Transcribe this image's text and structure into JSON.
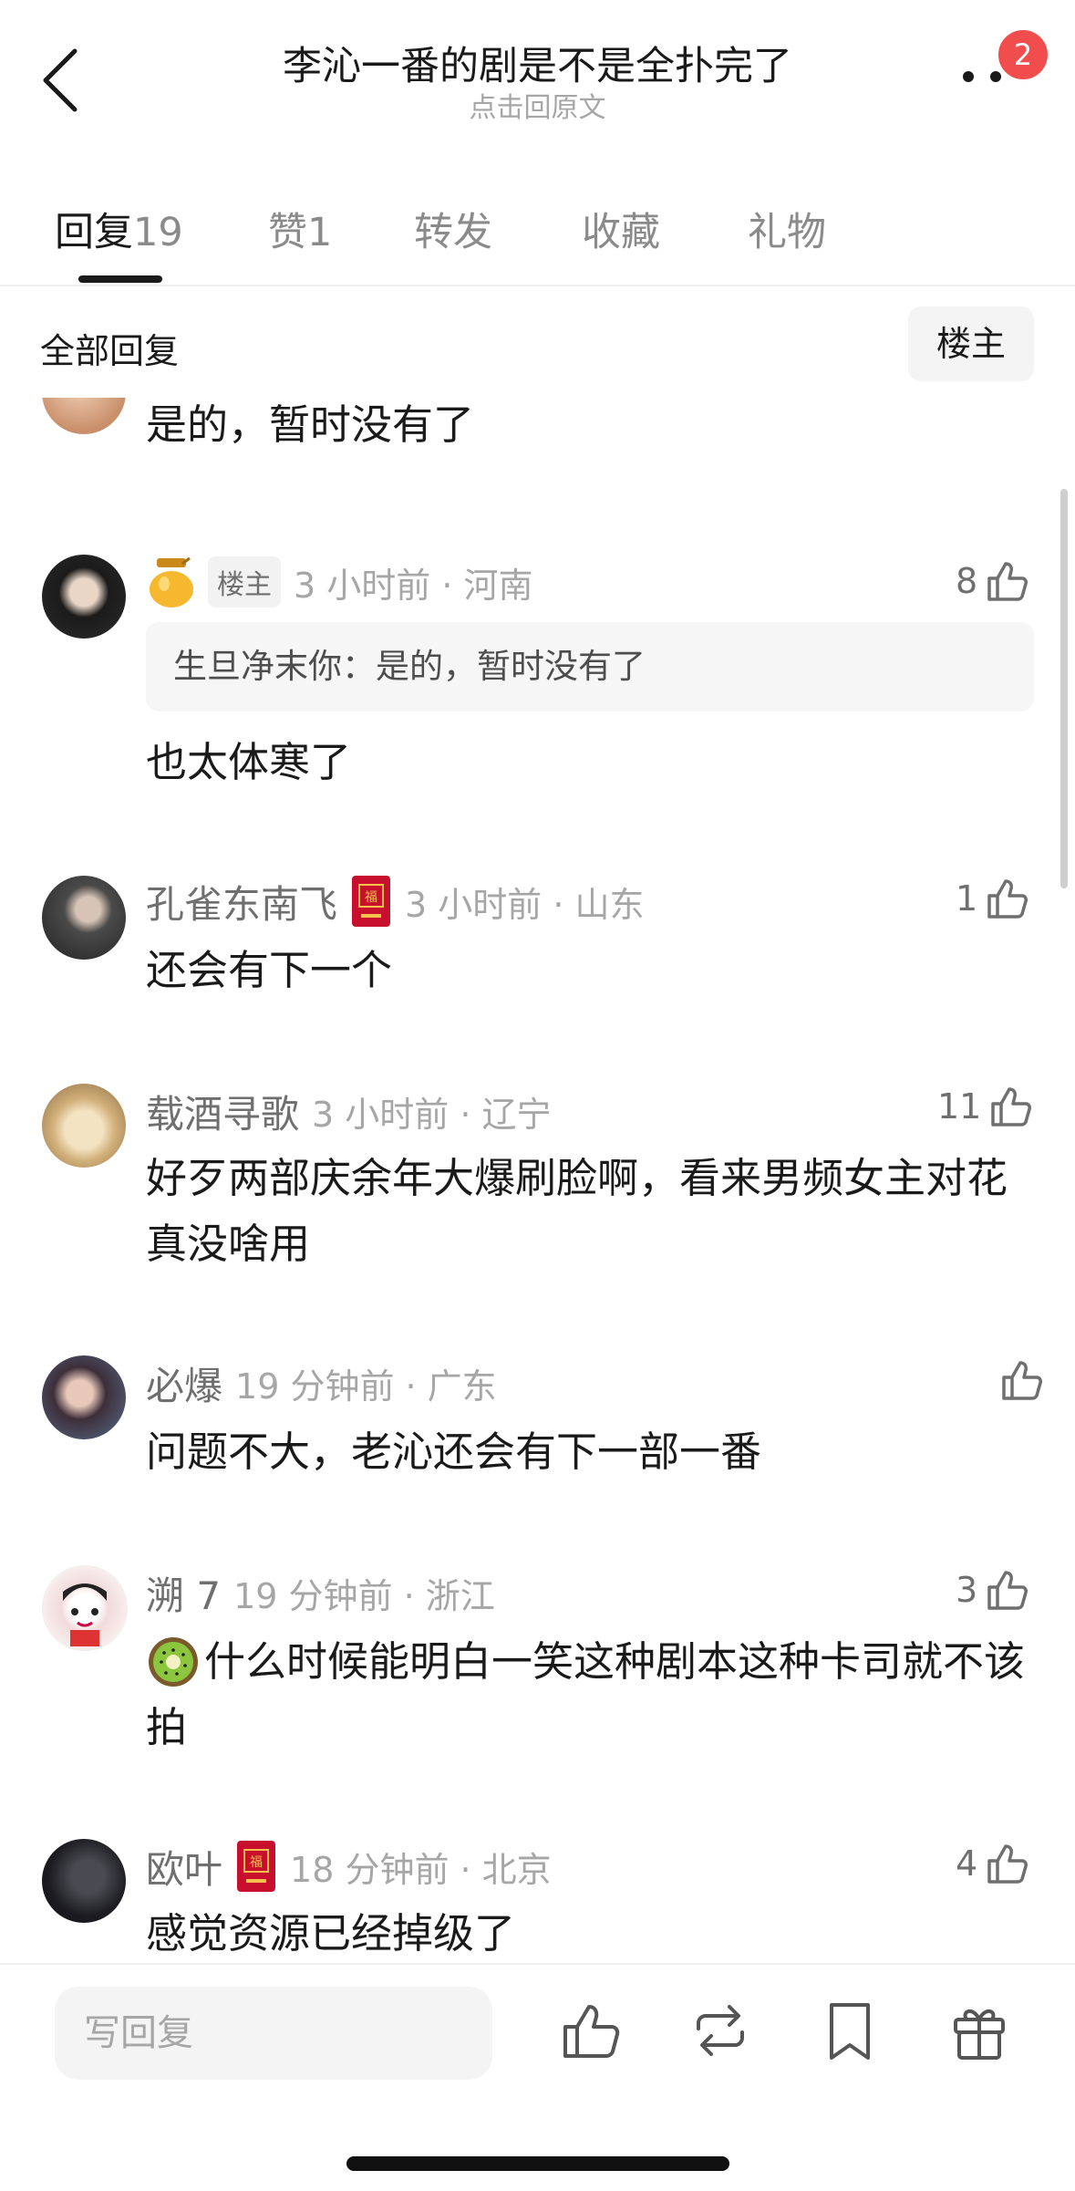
{
  "header": {
    "title": "李沁一番的剧是不是全扑完了",
    "subtitle": "点击回原文",
    "badge_count": "2"
  },
  "tabs": [
    {
      "label": "回复",
      "count": "19"
    },
    {
      "label": "赞",
      "count": "1"
    },
    {
      "label": "转发",
      "count": ""
    },
    {
      "label": "收藏",
      "count": ""
    },
    {
      "label": "礼物",
      "count": ""
    }
  ],
  "filter": {
    "label": "全部回复",
    "op_button": "楼主"
  },
  "partial_reply": {
    "content": "是的，暂时没有了"
  },
  "comments": [
    {
      "name": "",
      "op_tag": "楼主",
      "time": "3 小时前 · 河南",
      "likes": "8",
      "quote": "生旦净末你：是的，暂时没有了",
      "content": "也太体寒了"
    },
    {
      "name": "孔雀东南飞",
      "time": "3 小时前 · 山东",
      "likes": "1",
      "content": "还会有下一个"
    },
    {
      "name": "载酒寻歌",
      "time": "3 小时前 · 辽宁",
      "likes": "11",
      "content": "好歹两部庆余年大爆刷脸啊，看来男频女主对花真没啥用"
    },
    {
      "name": "必爆",
      "time": "19 分钟前 · 广东",
      "likes": "",
      "content": "问题不大，老沁还会有下一部一番"
    },
    {
      "name": "溯 7",
      "time": "19 分钟前 · 浙江",
      "likes": "3",
      "content": "什么时候能明白一笑这种剧本这种卡司就不该拍"
    },
    {
      "name": "欧叶",
      "time": "18 分钟前 · 北京",
      "likes": "4",
      "content": "感觉资源已经掉级了"
    }
  ],
  "bottom_bar": {
    "reply_placeholder": "写回复"
  },
  "icons": {
    "back": "chevron-left-icon",
    "more": "more-dots-icon",
    "like": "thumbs-up-icon",
    "repost": "repost-icon",
    "bookmark": "bookmark-icon",
    "gift": "gift-icon",
    "honey_jar": "honey-jar-icon",
    "red_envelope": "red-envelope-icon",
    "kiwi": "kiwi-emoji"
  },
  "colors": {
    "badge": "#f24d4d",
    "accent_text": "#1a1a1a",
    "muted": "#8c8c8c",
    "envelope": "#c8102e"
  }
}
